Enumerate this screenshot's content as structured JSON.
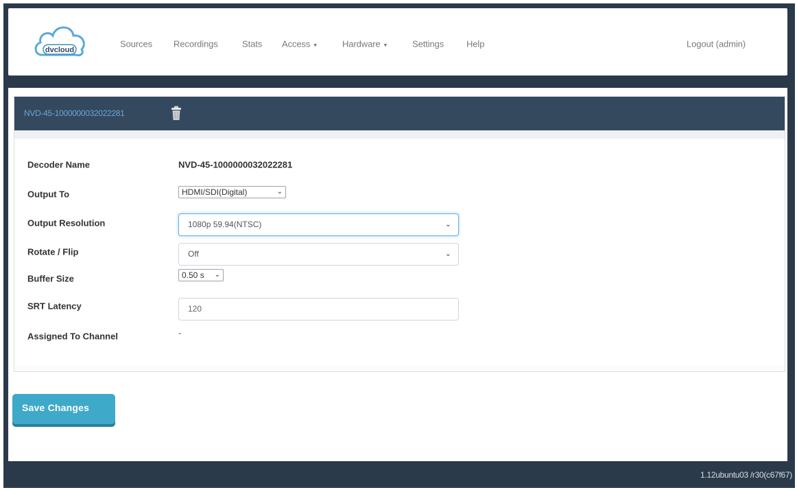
{
  "navbar": {
    "logo_text": "dvcloud",
    "items": [
      {
        "label": "Sources"
      },
      {
        "label": "Recordings"
      },
      {
        "label": "Stats"
      },
      {
        "label": "Access"
      },
      {
        "label": "Hardware"
      },
      {
        "label": "Settings"
      },
      {
        "label": "Help"
      }
    ],
    "logout_label": "Logout (admin)"
  },
  "panel": {
    "title": "NVD-45-1000000032022281",
    "trash_icon": "trash-icon"
  },
  "form": {
    "decoder_name": {
      "label": "Decoder Name",
      "value": "NVD-45-1000000032022281"
    },
    "output_to": {
      "label": "Output To",
      "value": "HDMI/SDI(Digital)"
    },
    "output_resolution": {
      "label": "Output Resolution",
      "value": "1080p 59.94(NTSC)"
    },
    "rotate_flip": {
      "label": "Rotate / Flip",
      "value": "Off"
    },
    "buffer_size": {
      "label": "Buffer Size",
      "value": "0.50 s"
    },
    "srt_latency": {
      "label": "SRT Latency",
      "value": "120"
    },
    "assigned_channel": {
      "label": "Assigned To Channel",
      "value": "-"
    }
  },
  "save_label": "Save Changes",
  "footer": {
    "version": "1.12ubuntu03 /r30(c67f67)"
  },
  "colors": {
    "frame": "#2b3a4a",
    "panel_heading": "#34495e",
    "title_link": "#6aa4d8",
    "save_button": "#3fa9c9"
  }
}
